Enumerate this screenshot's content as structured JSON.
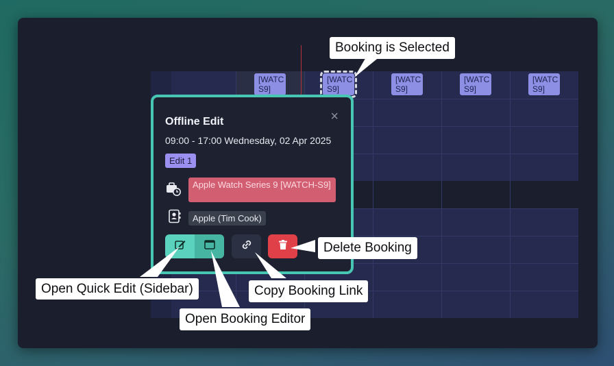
{
  "calendar": {
    "event_chips": [
      {
        "text": "[WATC\nS9]",
        "selected": false
      },
      {
        "text": "[WATC\nS9]",
        "selected": true
      },
      {
        "text": "[WATC\nS9]",
        "selected": false
      },
      {
        "text": "[WATC\nS9]",
        "selected": false
      },
      {
        "text": "[WATC\nS9]",
        "selected": false
      }
    ],
    "chip_color": "#8c8fe3",
    "now_line_color": "#b8323b"
  },
  "popover": {
    "title": "Offline Edit",
    "datetime": "09:00 - 17:00 Wednesday, 02 Apr 2025",
    "badge": "Edit 1",
    "product": "Apple Watch Series 9 [WATCH-S9]",
    "contact": "Apple (Tim Cook)",
    "close_icon": "×",
    "border_color": "#48c6b4",
    "buttons": {
      "quick_edit_icon": "edit-icon",
      "booking_editor_icon": "window-icon",
      "copy_link_icon": "link-icon",
      "delete_icon": "trash-icon"
    }
  },
  "callouts": {
    "booking_selected": "Booking is Selected",
    "delete_booking": "Delete Booking",
    "quick_edit": "Open Quick Edit (Sidebar)",
    "copy_link": "Copy Booking Link",
    "booking_editor": "Open Booking Editor"
  }
}
